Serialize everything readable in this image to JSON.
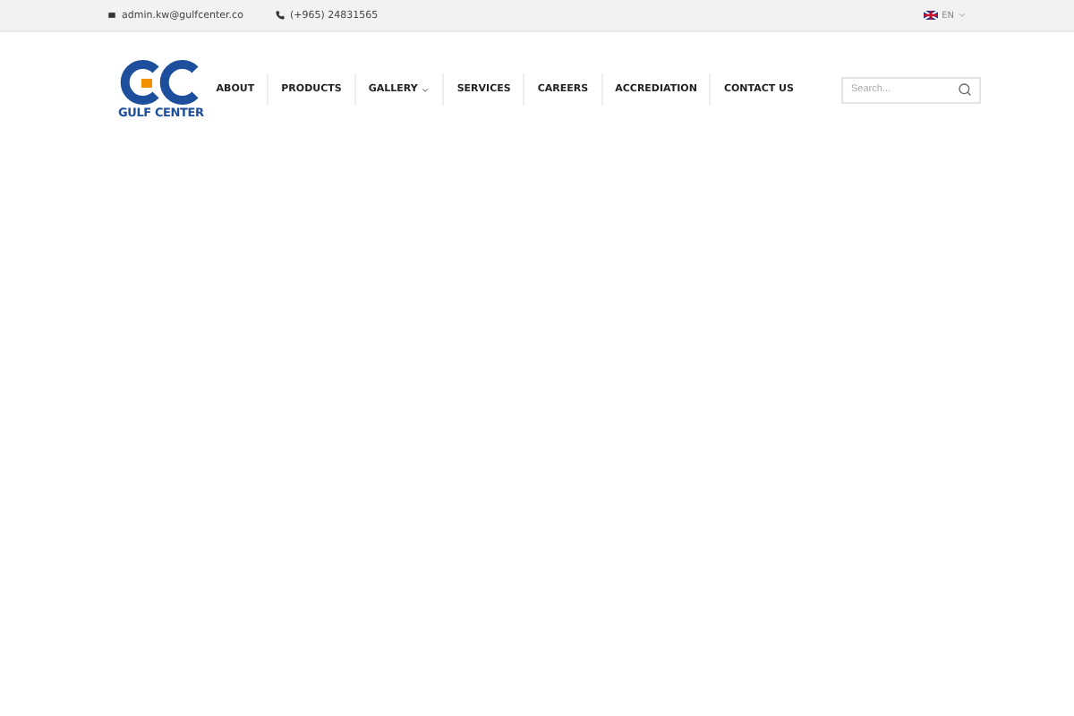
{
  "top_bar": {
    "email": "admin.kw@gulfcenter.co",
    "phone": "(+965) 24831565",
    "language": "EN"
  },
  "logo": {
    "name": "GULF CENTER"
  },
  "nav": [
    {
      "label": "ABOUT",
      "has_dropdown": false
    },
    {
      "label": "PRODUCTS",
      "has_dropdown": false
    },
    {
      "label": "GALLERY",
      "has_dropdown": true
    },
    {
      "label": "SERVICES",
      "has_dropdown": false
    },
    {
      "label": "CAREERS",
      "has_dropdown": false
    },
    {
      "label": "ACCREDIATION",
      "has_dropdown": false
    },
    {
      "label": "CONTACT US",
      "has_dropdown": false
    }
  ],
  "search": {
    "placeholder": "Search..."
  }
}
